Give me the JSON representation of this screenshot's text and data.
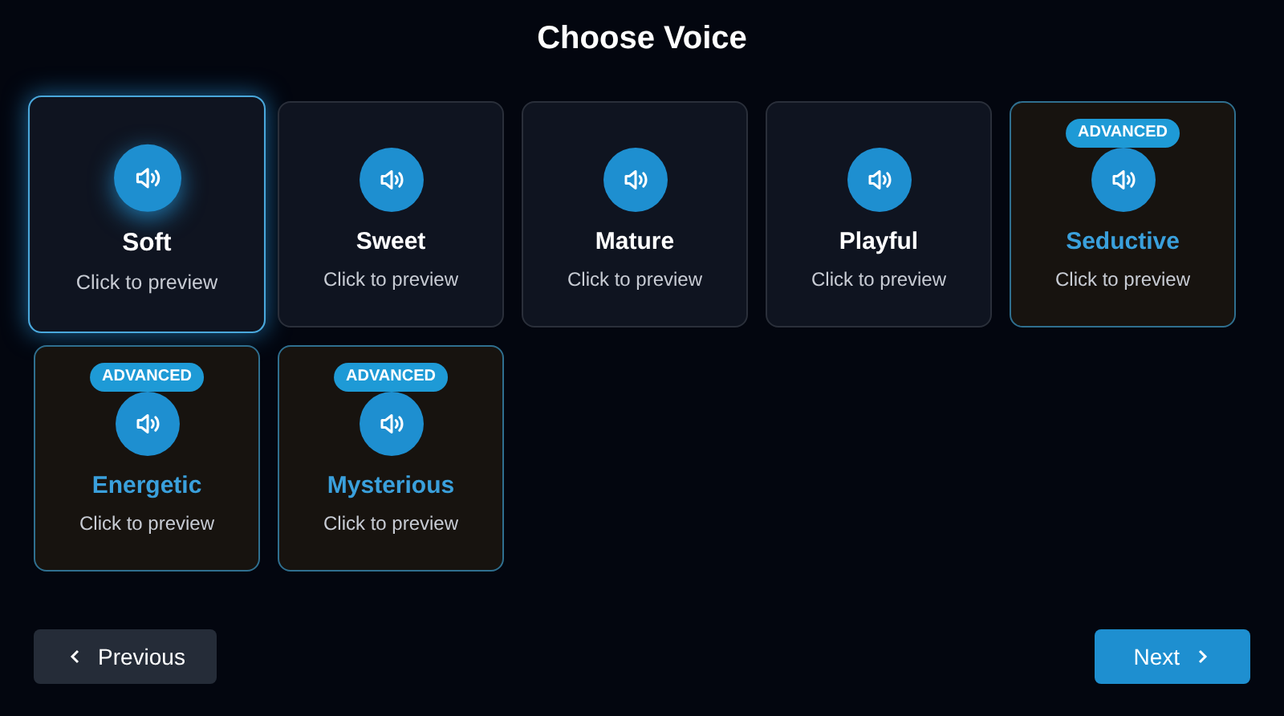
{
  "title": "Choose Voice",
  "voices": [
    {
      "name": "Soft",
      "hint": "Click to preview",
      "kind": "standard",
      "selected": true
    },
    {
      "name": "Sweet",
      "hint": "Click to preview",
      "kind": "standard",
      "selected": false
    },
    {
      "name": "Mature",
      "hint": "Click to preview",
      "kind": "standard",
      "selected": false
    },
    {
      "name": "Playful",
      "hint": "Click to preview",
      "kind": "standard",
      "selected": false
    },
    {
      "name": "Seductive",
      "hint": "Click to preview",
      "kind": "advanced",
      "badge": "ADVANCED",
      "selected": false
    },
    {
      "name": "Energetic",
      "hint": "Click to preview",
      "kind": "advanced",
      "badge": "ADVANCED",
      "selected": false
    },
    {
      "name": "Mysterious",
      "hint": "Click to preview",
      "kind": "advanced",
      "badge": "ADVANCED",
      "selected": false
    }
  ],
  "buttons": {
    "previous": "Previous",
    "next": "Next"
  }
}
